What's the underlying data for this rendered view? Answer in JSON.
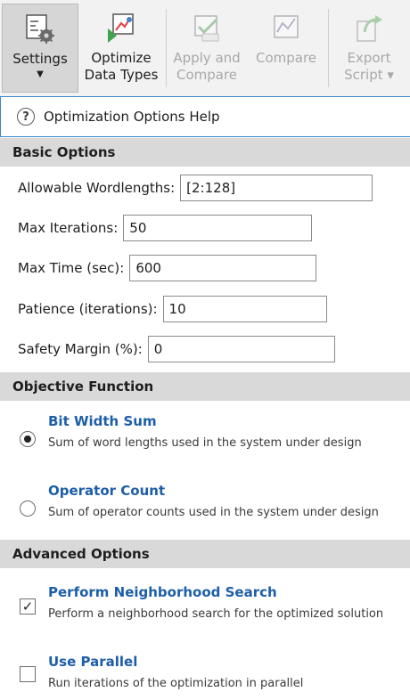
{
  "toolbar": {
    "settings": {
      "label": "Settings",
      "icon": "settings-icon",
      "selected": true
    },
    "optimize": {
      "label": "Optimize\nData Types",
      "icon": "optimize-icon"
    },
    "apply": {
      "label": "Apply and\nCompare",
      "icon": "apply-icon",
      "disabled": true
    },
    "compare": {
      "label": "Compare",
      "icon": "compare-icon",
      "disabled": true
    },
    "export": {
      "label": "Export\nScript ▾",
      "icon": "export-icon",
      "disabled": true
    }
  },
  "help": {
    "label": "Optimization Options Help",
    "icon": "help-icon"
  },
  "basic_options": {
    "title": "Basic Options",
    "wordlengths": {
      "label": "Allowable Wordlengths:",
      "value": "[2:128]"
    },
    "max_iterations": {
      "label": "Max Iterations:",
      "value": "50"
    },
    "max_time": {
      "label": "Max Time (sec):",
      "value": "600"
    },
    "patience": {
      "label": "Patience (iterations):",
      "value": "10"
    },
    "safety_margin": {
      "label": "Safety Margin (%):",
      "value": "0"
    }
  },
  "objective": {
    "title": "Objective Function",
    "options": [
      {
        "title": "Bit Width Sum",
        "desc": "Sum of word lengths used in the system under design",
        "selected": true
      },
      {
        "title": "Operator Count",
        "desc": "Sum of operator counts used in the system under design",
        "selected": false
      }
    ]
  },
  "advanced": {
    "title": "Advanced Options",
    "options": [
      {
        "title": "Perform Neighborhood Search",
        "desc": "Perform a neighborhood search for the optimized solution",
        "checked": true
      },
      {
        "title": "Use Parallel",
        "desc": "Run iterations of the optimization in parallel",
        "checked": false
      }
    ]
  },
  "colors": {
    "link_blue": "#1d5ea8",
    "header_gray": "#d9d9d9",
    "focus_blue": "#3c86c8"
  }
}
